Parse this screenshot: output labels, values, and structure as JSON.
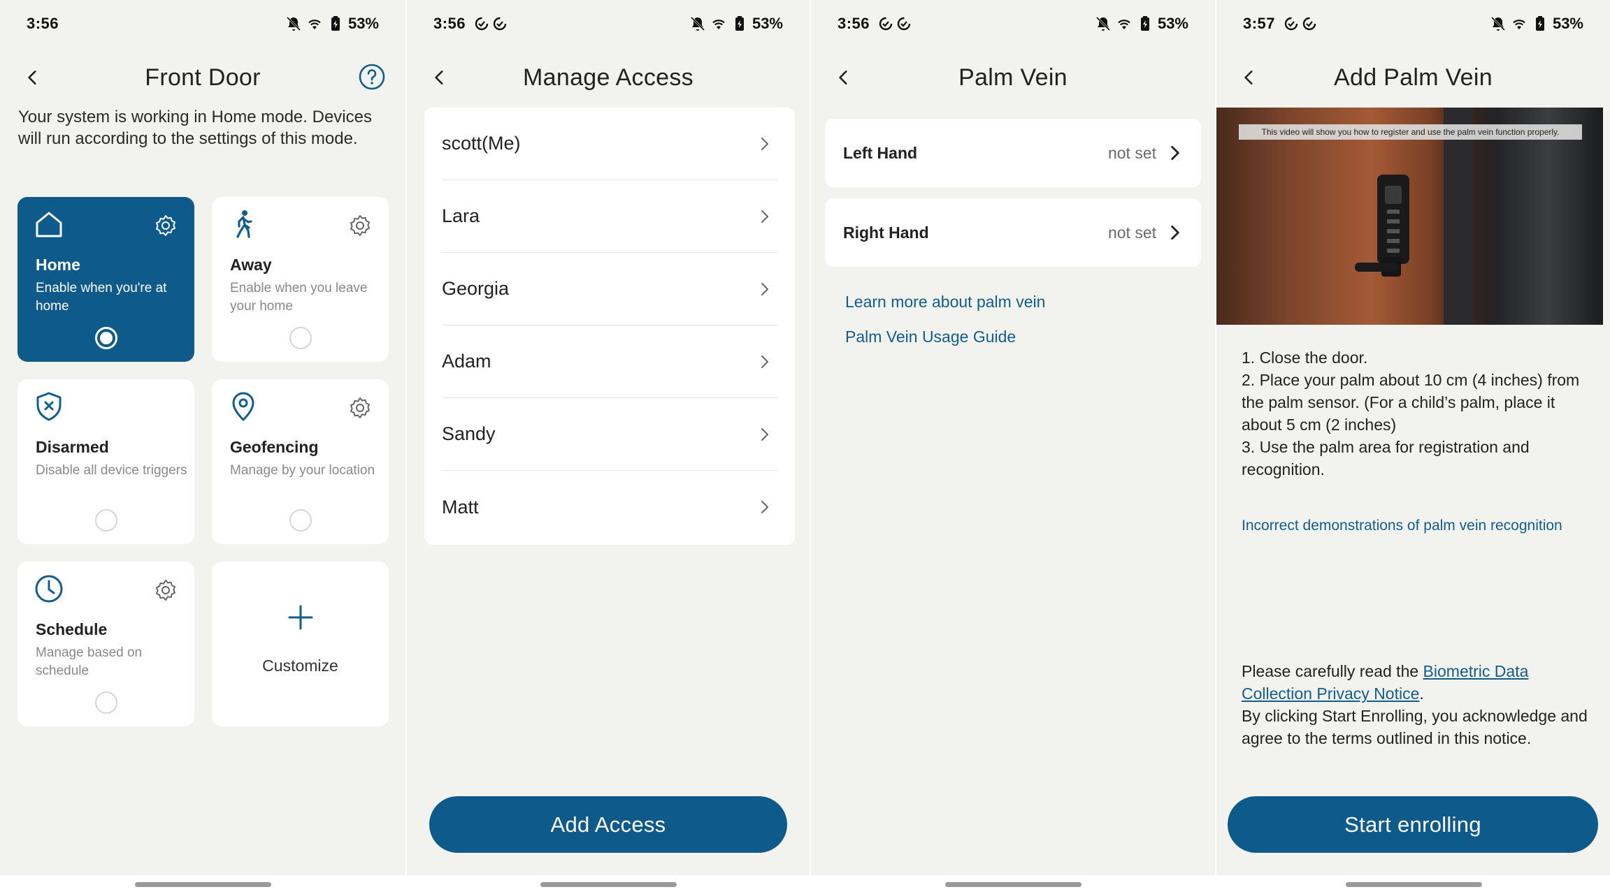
{
  "colors": {
    "accent": "#0e5a8a",
    "link": "#135d8d",
    "background": "#f2f2ef",
    "card": "#ffffff"
  },
  "screens": [
    {
      "status": {
        "time": "3:56",
        "battery": "53%",
        "sync_icons": false
      },
      "header": {
        "title": "Front Door",
        "back_icon": "chevron-left-icon",
        "help_icon": "help-circle-icon"
      },
      "description": "Your system is working in Home mode. Devices will run according to the settings of this mode.",
      "modes": [
        {
          "name": "Home",
          "sub": "Enable when you're at home",
          "icon": "home-icon",
          "has_gear": true,
          "selected": true
        },
        {
          "name": "Away",
          "sub": "Enable when you leave your home",
          "icon": "walking-person-icon",
          "has_gear": true,
          "selected": false
        },
        {
          "name": "Disarmed",
          "sub": "Disable all device triggers",
          "icon": "shield-x-icon",
          "has_gear": false,
          "selected": false
        },
        {
          "name": "Geofencing",
          "sub": "Manage by your location",
          "icon": "location-pin-icon",
          "has_gear": true,
          "selected": false
        },
        {
          "name": "Schedule",
          "sub": "Manage based on schedule",
          "icon": "clock-icon",
          "has_gear": true,
          "selected": false
        }
      ],
      "customize": {
        "label": "Customize",
        "icon": "plus-icon"
      }
    },
    {
      "status": {
        "time": "3:56",
        "battery": "53%",
        "sync_icons": true
      },
      "header": {
        "title": "Manage Access"
      },
      "users": [
        "scott(Me)",
        "Lara",
        "Georgia",
        "Adam",
        "Sandy",
        "Matt"
      ],
      "button": "Add Access"
    },
    {
      "status": {
        "time": "3:56",
        "battery": "53%",
        "sync_icons": true
      },
      "header": {
        "title": "Palm Vein"
      },
      "hands": [
        {
          "label": "Left Hand",
          "status": "not set"
        },
        {
          "label": "Right Hand",
          "status": "not set"
        }
      ],
      "links": [
        "Learn more about palm vein",
        "Palm Vein Usage Guide"
      ]
    },
    {
      "status": {
        "time": "3:57",
        "battery": "53%",
        "sync_icons": true
      },
      "header": {
        "title": "Add Palm Vein"
      },
      "video_caption": "This video will show you how to register and use the palm vein function properly.",
      "instructions": [
        "1. Close the door.",
        "2. Place your palm about 10 cm (4 inches) from the palm sensor. (For a child’s palm, place it about 5 cm (2 inches)",
        "3. Use the palm area for registration and recognition."
      ],
      "demo_link": "Incorrect demonstrations of palm vein recognition",
      "notice": {
        "prefix": "Please carefully read the ",
        "link": "Biometric Data Collection Privacy Notice",
        "suffix": ".",
        "body": "By clicking Start Enrolling, you acknowledge and agree to the terms outlined in this notice."
      },
      "button": "Start enrolling"
    }
  ]
}
